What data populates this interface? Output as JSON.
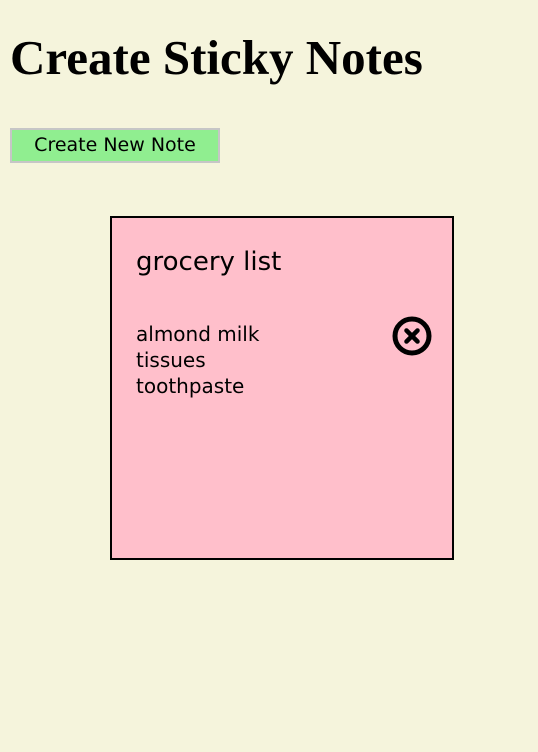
{
  "page": {
    "title": "Create Sticky Notes",
    "background_color": "#f5f4dc"
  },
  "toolbar": {
    "create_button_label": "Create New Note",
    "create_button_color": "#90ee90"
  },
  "notes": [
    {
      "title": "grocery list",
      "items": [
        "almond milk",
        "tissues",
        "toothpaste"
      ],
      "background_color": "#ffbfcb",
      "delete_icon": "close-circle-icon"
    }
  ]
}
